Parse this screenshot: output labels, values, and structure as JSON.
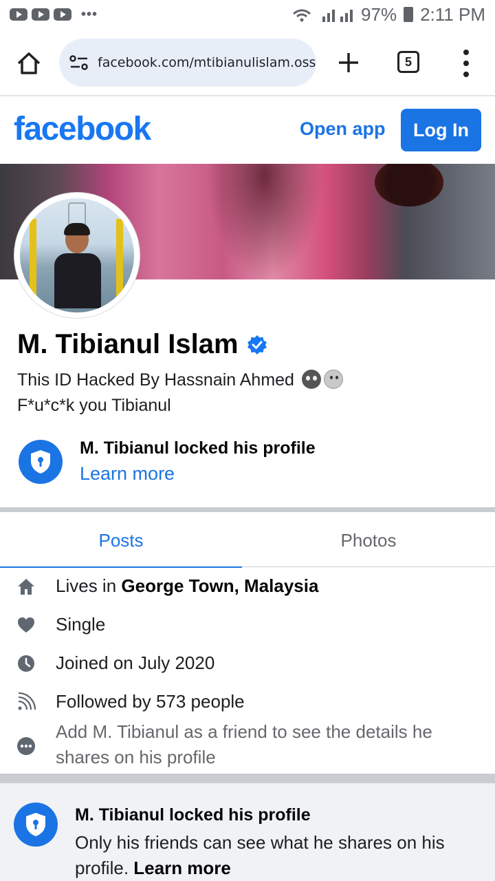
{
  "status_bar": {
    "battery": "97%",
    "time": "2:11 PM"
  },
  "browser": {
    "url": "facebook.com/mtibianulislam.ossc",
    "tab_count": "5"
  },
  "header": {
    "logo": "facebook",
    "open_app": "Open app",
    "login": "Log In"
  },
  "profile": {
    "name": "M. Tibianul Islam",
    "bio_line1": "This ID Hacked By Hassnain Ahmed",
    "bio_line2": "F*u*c*k you Tibianul",
    "locked_title": "M. Tibianul locked his profile",
    "learn_more": "Learn more"
  },
  "tabs": [
    {
      "label": "Posts",
      "active": true
    },
    {
      "label": "Photos",
      "active": false
    }
  ],
  "details": {
    "lives_prefix": "Lives in",
    "lives_place": "George Town, Malaysia",
    "relationship": "Single",
    "joined": "Joined on July 2020",
    "followers": "Followed by 573 people",
    "add_friend_note": "Add M. Tibianul as a friend to see the details he shares on his profile"
  },
  "locked_card": {
    "title": "M. Tibianul locked his profile",
    "desc": "Only his friends can see what he shares on his profile.",
    "link": "Learn more"
  },
  "icons": {
    "home": "home-icon",
    "site_settings": "tune-icon",
    "new_tab": "plus-icon",
    "tabs": "tabs-count-icon",
    "menu": "more-vert-icon",
    "verified": "verified-badge-icon",
    "lock": "lock-shield-icon",
    "house": "house-icon",
    "heart": "heart-icon",
    "clock": "clock-icon",
    "rss": "rss-icon",
    "more": "more-horizontal-icon"
  },
  "colors": {
    "brand": "#1877f2",
    "link": "#1b74e4",
    "text": "#050505",
    "muted": "#65676b",
    "separator": "#c9ccd1"
  }
}
